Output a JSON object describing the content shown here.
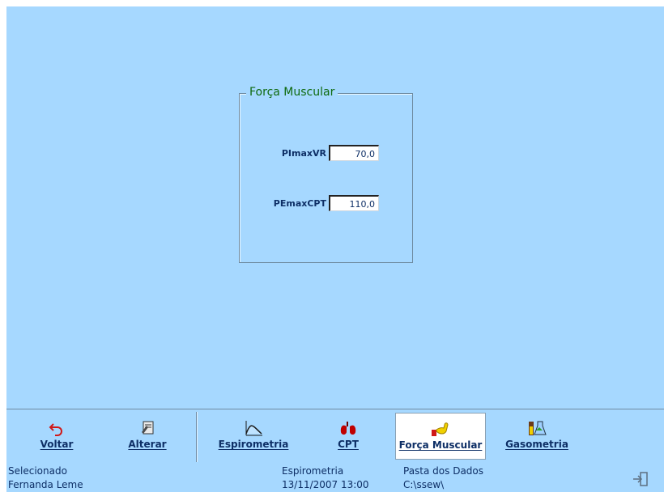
{
  "group": {
    "title": "Força Muscular",
    "fields": [
      {
        "label": "PImaxVR",
        "value": "70,0"
      },
      {
        "label": "PEmaxCPT",
        "value": "110,0"
      }
    ]
  },
  "toolbar": {
    "buttons": [
      {
        "label": "Voltar",
        "icon": "undo-arrow-icon",
        "active": false
      },
      {
        "label": "Alterar",
        "icon": "edit-doc-icon",
        "active": false
      },
      {
        "label": "Espirometria",
        "icon": "spirometry-curve-icon",
        "active": false
      },
      {
        "label": "CPT",
        "icon": "lungs-icon",
        "active": false
      },
      {
        "label": "Força Muscular",
        "icon": "muscle-arm-icon",
        "active": true
      },
      {
        "label": "Gasometria",
        "icon": "lab-flasks-icon",
        "active": false
      }
    ]
  },
  "status": {
    "selected_label": "Selecionado",
    "patient_name": "Fernanda Leme",
    "exam_name": "Espirometria",
    "exam_datetime": "13/11/2007 13:00",
    "folder_label": "Pasta dos Dados",
    "folder_path": "C:\\ssew\\"
  },
  "colors": {
    "background": "#a6d8ff",
    "title_green": "#0f6a0f",
    "text_navy": "#0e2f66"
  },
  "icons": {
    "exit": "exit-door-icon"
  }
}
